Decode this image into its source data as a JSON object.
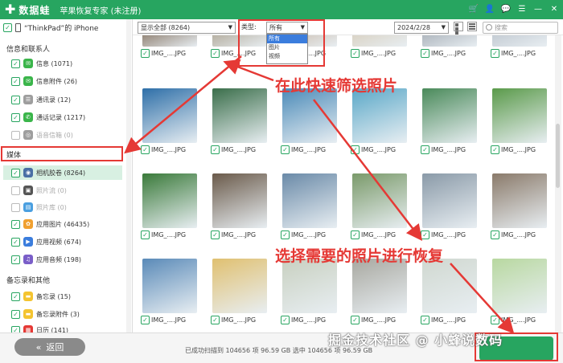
{
  "titlebar": {
    "logo_text": "数据蛙",
    "app_title": "苹果恢复专家 (未注册)"
  },
  "device": {
    "name": "“ThinkPad”的 iPhone"
  },
  "sidebar": {
    "groups": [
      {
        "title": "信息和联系人",
        "items": [
          {
            "label": "信息 (1071)",
            "checked": true,
            "icon": "message-icon",
            "color": "#3ab54a"
          },
          {
            "label": "信息附件 (26)",
            "checked": true,
            "icon": "message-attachment-icon",
            "color": "#3ab54a"
          },
          {
            "label": "通讯录 (12)",
            "checked": true,
            "icon": "contacts-icon",
            "color": "#9e9e9e"
          },
          {
            "label": "通话记录 (1217)",
            "checked": true,
            "icon": "phone-icon",
            "color": "#3ab54a"
          },
          {
            "label": "语音信箱 (0)",
            "checked": false,
            "icon": "voicemail-icon",
            "color": "#9e9e9e"
          }
        ]
      },
      {
        "title": "媒体",
        "items": [
          {
            "label": "相机胶卷 (8264)",
            "checked": true,
            "icon": "camera-icon",
            "color": "#4a6fa5"
          },
          {
            "label": "照片流 (0)",
            "checked": false,
            "icon": "photo-stream-icon",
            "color": "#555555"
          },
          {
            "label": "照片库 (0)",
            "checked": false,
            "icon": "photo-library-icon",
            "color": "#4a9fe0"
          },
          {
            "label": "应用图片 (46435)",
            "checked": true,
            "icon": "app-photos-icon",
            "color": "#f0a030"
          },
          {
            "label": "应用视频 (674)",
            "checked": true,
            "icon": "app-videos-icon",
            "color": "#3b7ddd"
          },
          {
            "label": "应用音频 (198)",
            "checked": true,
            "icon": "app-audio-icon",
            "color": "#7a5ec8"
          }
        ]
      },
      {
        "title": "备忘录和其他",
        "items": [
          {
            "label": "备忘录 (15)",
            "checked": true,
            "icon": "notes-icon",
            "color": "#f4c430"
          },
          {
            "label": "备忘录附件 (3)",
            "checked": true,
            "icon": "notes-attachment-icon",
            "color": "#f4c430"
          },
          {
            "label": "日历 (141)",
            "checked": true,
            "icon": "calendar-icon",
            "color": "#e53935"
          }
        ]
      }
    ]
  },
  "toolbar": {
    "show_filter": "显示全部 (8264)",
    "type_label": "类型:",
    "type_value": "所有",
    "date_value": "2024/2/28",
    "search_placeholder": "搜索"
  },
  "type_dropdown": {
    "options": [
      "所有",
      "图片",
      "视频"
    ],
    "selected": "所有"
  },
  "photos": {
    "caption": "IMG_....JPG",
    "rows": [
      [
        "#8a7a6a",
        "#b0a898",
        "#c8b8a8",
        "#d8d0c0",
        "#a8b0b8",
        "#c0c8d0"
      ],
      [
        "#2e6fa8",
        "#3a6e4a",
        "#4a8ab8",
        "#5aa8c8",
        "#4a8a5a",
        "#5a9a4a"
      ],
      [
        "#3a7a3a",
        "#6a5a4a",
        "#6a8aa8",
        "#7a9a6a",
        "#8a9aa8",
        "#8a7a6a"
      ],
      [
        "#5a8ab8",
        "#e0c070",
        "#c8d0c0",
        "#a8a8a0",
        "#d0d8d0",
        "#b8d8a0"
      ]
    ]
  },
  "annotations": {
    "filter_hint": "在此快速筛选照片",
    "select_hint": "选择需要的照片进行恢复"
  },
  "bottom": {
    "back_label": "返回",
    "status_text": "已成功扫描到 104656 项 96.59 GB  选中 104656 项 96.59 GB"
  },
  "watermark": "掘金技术社区 @ 小蜂说数码"
}
